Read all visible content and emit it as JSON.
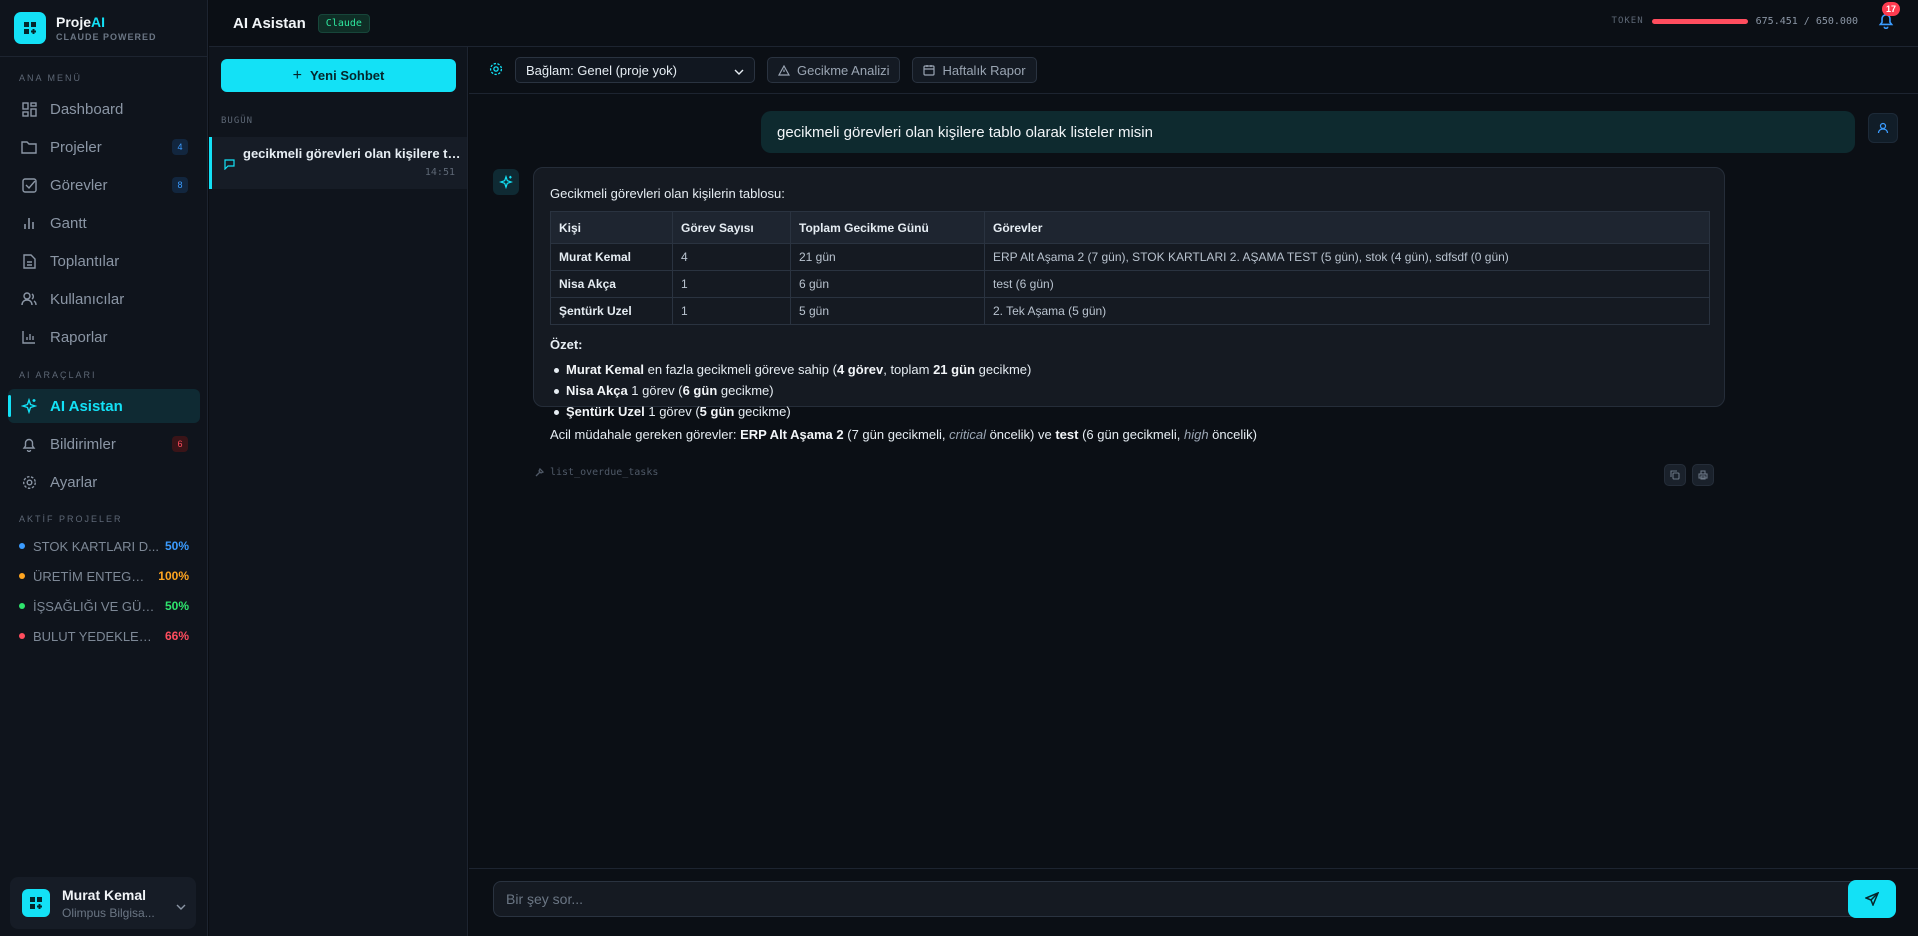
{
  "app": {
    "name_prefix": "Proje",
    "name_suffix": "AI",
    "tagline": "CLAUDE POWERED"
  },
  "colors": {
    "accent": "#13e1f6",
    "danger": "#ff4d5e",
    "success": "#2ee59d"
  },
  "sidebar": {
    "main_menu_title": "ANA MENÜ",
    "items": [
      {
        "label": "Dashboard",
        "icon": "grid-icon"
      },
      {
        "label": "Projeler",
        "icon": "folder-icon",
        "badge": "4"
      },
      {
        "label": "Görevler",
        "icon": "checkbox-icon",
        "badge": "8"
      },
      {
        "label": "Gantt",
        "icon": "bar-chart-icon"
      },
      {
        "label": "Toplantılar",
        "icon": "document-icon"
      },
      {
        "label": "Kullanıcılar",
        "icon": "users-icon"
      },
      {
        "label": "Raporlar",
        "icon": "chart-icon"
      }
    ],
    "ai_tools_title": "AI ARAÇLARI",
    "ai_items": [
      {
        "label": "AI Asistan",
        "icon": "sparkle-icon",
        "active": true
      },
      {
        "label": "Bildirimler",
        "icon": "bell-icon",
        "badge": "6"
      },
      {
        "label": "Ayarlar",
        "icon": "gear-icon"
      }
    ],
    "projects_title": "AKTİF PROJELER",
    "projects": [
      {
        "name": "STOK KARTLARI D...",
        "pct": "50%",
        "color": "#3b9cff"
      },
      {
        "name": "ÜRETİM ENTEGRA...",
        "pct": "100%",
        "color": "#ffa520"
      },
      {
        "name": "İŞSAĞLIĞI VE GÜV...",
        "pct": "50%",
        "color": "#2ee56d"
      },
      {
        "name": "BULUT YEDEKLEM...",
        "pct": "66%",
        "color": "#ff4d5e"
      }
    ],
    "user": {
      "name": "Murat Kemal",
      "org": "Olimpus Bilgisa..."
    }
  },
  "topbar": {
    "title": "AI Asistan",
    "model": "Claude",
    "token_label": "TOKEN",
    "token_value": "675.451 / 650.000",
    "token_fraction": 1.0,
    "notifications": "17"
  },
  "chatlist": {
    "new_chat": "Yeni Sohbet",
    "today_label": "BUGÜN",
    "items": [
      {
        "title": "gecikmeli görevleri olan kişilere tab...",
        "time": "14:51"
      }
    ]
  },
  "toolbar": {
    "context": "Bağlam: Genel (proje yok)",
    "delay_btn": "Gecikme Analizi",
    "weekly_btn": "Haftalık Rapor"
  },
  "conversation": {
    "user_message": "gecikmeli görevleri olan kişilere tablo olarak listeler misin",
    "assistant": {
      "intro": "Gecikmeli görevleri olan kişilerin tablosu:",
      "table": {
        "headers": [
          "Kişi",
          "Görev Sayısı",
          "Toplam Gecikme Günü",
          "Görevler"
        ],
        "rows": [
          [
            "Murat Kemal",
            "4",
            "21 gün",
            "ERP Alt Aşama 2 (7 gün), STOK KARTLARI 2. AŞAMA TEST (5 gün), stok (4 gün), sdfsdf (0 gün)"
          ],
          [
            "Nisa Akça",
            "1",
            "6 gün",
            "test (6 gün)"
          ],
          [
            "Şentürk Uzel",
            "1",
            "5 gün",
            "2. Tek Aşama (5 gün)"
          ]
        ]
      },
      "summary_title": "Özet:",
      "summary": [
        {
          "name": "Murat Kemal",
          "t1": " en fazla gecikmeli göreve sahip (",
          "b1": "4 görev",
          "t2": ", toplam ",
          "b2": "21 gün",
          "t3": " gecikme)"
        },
        {
          "name": "Nisa Akça",
          "t1": " 1 görev (",
          "b1": "6 gün",
          "t2": " gecikme)"
        },
        {
          "name": "Şentürk Uzel",
          "t1": " 1 görev (",
          "b1": "5 gün",
          "t2": " gecikme)"
        }
      ],
      "final": {
        "p1": "Acil müdahale gereken görevler: ",
        "b1": "ERP Alt Aşama 2",
        "p2": " (7 gün gecikmeli, ",
        "i1": "critical",
        "p3": " öncelik) ve ",
        "b2": "test",
        "p4": " (6 gün gecikmeli, ",
        "i2": "high",
        "p5": " öncelik)"
      },
      "tool": "list_overdue_tasks"
    }
  },
  "composer": {
    "placeholder": "Bir şey sor..."
  }
}
